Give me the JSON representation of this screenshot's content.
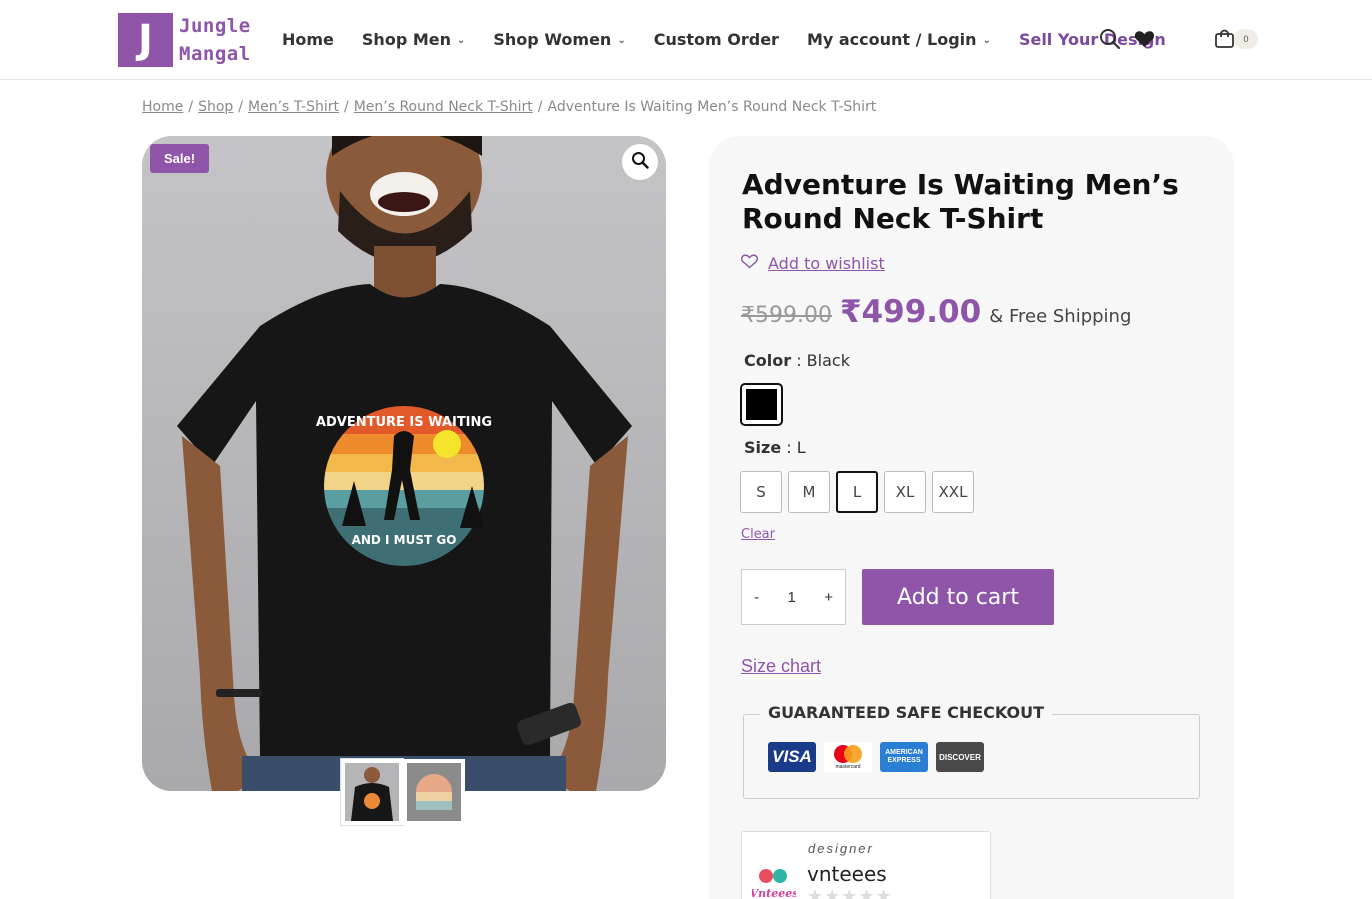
{
  "brand": {
    "logo_letter": "J",
    "line1": "Jungle",
    "line2": "Mangal",
    "accent_color": "#8e55a9"
  },
  "nav": {
    "items": [
      {
        "label": "Home",
        "has_dropdown": false
      },
      {
        "label": "Shop Men",
        "has_dropdown": true
      },
      {
        "label": "Shop Women",
        "has_dropdown": true
      },
      {
        "label": "Custom Order",
        "has_dropdown": false
      },
      {
        "label": "My account / Login",
        "has_dropdown": true
      }
    ],
    "sell_label": "Sell Your Design",
    "icons": [
      "search-icon",
      "heart-icon",
      "cart-icon"
    ],
    "cart_count": "0"
  },
  "breadcrumb": {
    "links": [
      "Home",
      "Shop",
      "Men’s T-Shirt",
      "Men’s Round Neck T-Shirt"
    ],
    "current": "Adventure Is Waiting Men’s Round Neck T-Shirt"
  },
  "gallery": {
    "badge": "Sale!",
    "print_top": "ADVENTURE IS WAITING",
    "print_bottom": "AND I MUST GO",
    "thumb_count": 2
  },
  "product": {
    "title": "Adventure Is Waiting Men’s Round Neck T-Shirt",
    "wishlist_label": "Add to wishlist",
    "old_price": "₹599.00",
    "new_price": "₹499.00",
    "shipping": "& Free Shipping",
    "color_label": "Color",
    "color_value": "Black",
    "size_label": "Size",
    "size_value": "L",
    "sizes": [
      "S",
      "M",
      "L",
      "XL",
      "XXL"
    ],
    "selected_size": "L",
    "clear_label": "Clear",
    "qty_minus": "-",
    "qty_value": "1",
    "qty_plus": "+",
    "add_to_cart": "Add to cart",
    "size_chart": "Size chart",
    "checkout_title": "GUARANTEED SAFE CHECKOUT",
    "cards": [
      "VISA",
      "mastercard",
      "AMERICAN EXPRESS",
      "DISCOVER"
    ],
    "designer_caption": "designer",
    "designer_name": "vnteees",
    "designer_logo_text": "Vnteees"
  }
}
